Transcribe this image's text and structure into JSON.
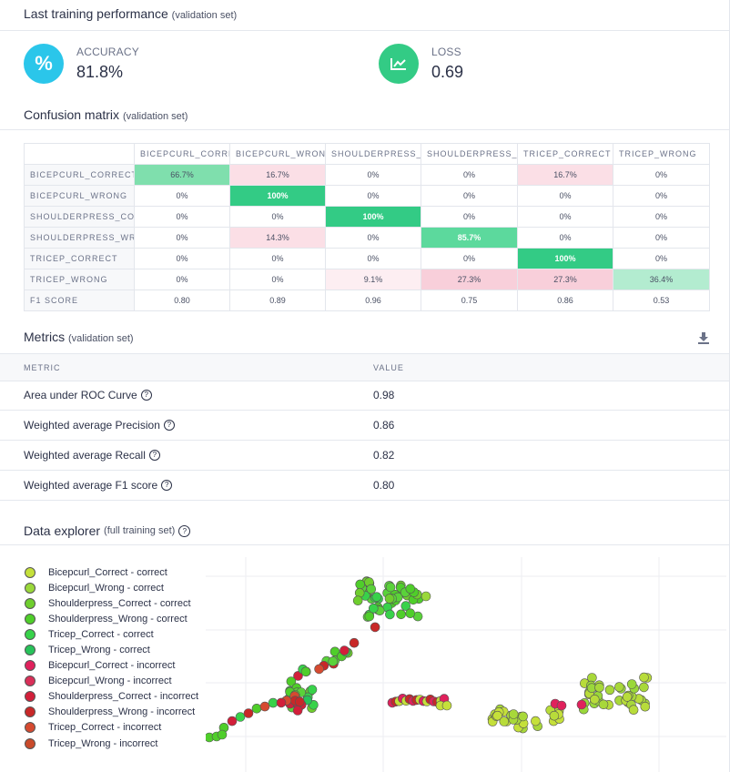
{
  "performance": {
    "title": "Last training performance",
    "subtitle": "(validation set)",
    "accuracy": {
      "label": "ACCURACY",
      "value": "81.8%",
      "icon_symbol": "%",
      "color": "#2bc6ea"
    },
    "loss": {
      "label": "LOSS",
      "value": "0.69",
      "color": "#33cb85"
    }
  },
  "confusion": {
    "title": "Confusion matrix",
    "subtitle": "(validation set)",
    "columns": [
      "BICEPCURL_CORRECT",
      "BICEPCURL_WRONG",
      "SHOULDERPRESS_CORRECT",
      "SHOULDERPRESS_WRONG",
      "TRICEP_CORRECT",
      "TRICEP_WRONG"
    ],
    "rows": [
      {
        "label": "BICEPCURL_CORRECT",
        "cells": [
          "66.7%",
          "16.7%",
          "0%",
          "0%",
          "16.7%",
          "0%"
        ]
      },
      {
        "label": "BICEPCURL_WRONG",
        "cells": [
          "0%",
          "100%",
          "0%",
          "0%",
          "0%",
          "0%"
        ]
      },
      {
        "label": "SHOULDERPRESS_CORRECT",
        "cells": [
          "0%",
          "0%",
          "100%",
          "0%",
          "0%",
          "0%"
        ]
      },
      {
        "label": "SHOULDERPRESS_WRONG",
        "cells": [
          "0%",
          "14.3%",
          "0%",
          "85.7%",
          "0%",
          "0%"
        ]
      },
      {
        "label": "TRICEP_CORRECT",
        "cells": [
          "0%",
          "0%",
          "0%",
          "0%",
          "100%",
          "0%"
        ]
      },
      {
        "label": "TRICEP_WRONG",
        "cells": [
          "0%",
          "0%",
          "9.1%",
          "27.3%",
          "27.3%",
          "36.4%"
        ]
      }
    ],
    "f1": {
      "label": "F1 SCORE",
      "cells": [
        "0.80",
        "0.89",
        "0.96",
        "0.75",
        "0.86",
        "0.53"
      ]
    },
    "colors": {
      "diag_strong": "#33cb85",
      "diag_mid": "#5cd99d",
      "diag_light": "#7fdfad",
      "diag_pale": "#b3ecd0",
      "off_pink": "#fbdfe6",
      "off_pale": "#fdeef2"
    }
  },
  "metrics": {
    "title": "Metrics",
    "subtitle": "(validation set)",
    "download_icon": "download-icon",
    "header_metric": "METRIC",
    "header_value": "VALUE",
    "rows": [
      {
        "name": "Area under ROC Curve",
        "value": "0.98"
      },
      {
        "name": "Weighted average Precision",
        "value": "0.86"
      },
      {
        "name": "Weighted average Recall",
        "value": "0.82"
      },
      {
        "name": "Weighted average F1 score",
        "value": "0.80"
      }
    ]
  },
  "explorer": {
    "title": "Data explorer",
    "subtitle": "(full training set)",
    "legend": [
      {
        "label": "Bicepcurl_Correct - correct",
        "color": "#c5e03a"
      },
      {
        "label": "Bicepcurl_Wrong - correct",
        "color": "#9ad83a"
      },
      {
        "label": "Shoulderpress_Correct - correct",
        "color": "#6fce2e"
      },
      {
        "label": "Shoulderpress_Wrong - correct",
        "color": "#4fce2a"
      },
      {
        "label": "Tricep_Correct - correct",
        "color": "#38d24a"
      },
      {
        "label": "Tricep_Wrong - correct",
        "color": "#28c25a"
      },
      {
        "label": "Bicepcurl_Correct - incorrect",
        "color": "#e0215c"
      },
      {
        "label": "Bicepcurl_Wrong - incorrect",
        "color": "#d92f58"
      },
      {
        "label": "Shoulderpress_Correct - incorrect",
        "color": "#d21f3a"
      },
      {
        "label": "Shoulderpress_Wrong - incorrect",
        "color": "#c82828"
      },
      {
        "label": "Tricep_Correct - incorrect",
        "color": "#d64a30"
      },
      {
        "label": "Tricep_Wrong - incorrect",
        "color": "#c94a2a"
      }
    ]
  }
}
